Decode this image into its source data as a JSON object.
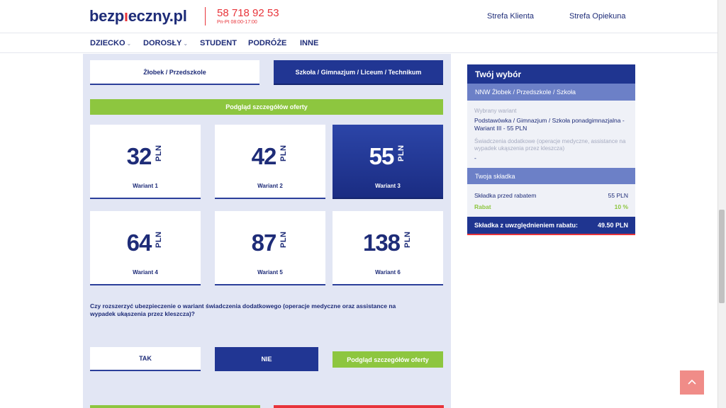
{
  "header": {
    "logo_pre": "bezp",
    "logo_mark": "ı",
    "logo_post": "eczny.pl",
    "phone": "58 718 92 53",
    "hours": "Pn-Pt 08:00-17:00",
    "links": [
      "Strefa Klienta",
      "Strefa Opiekuna"
    ]
  },
  "nav": {
    "items": [
      {
        "label": "DZIECKO",
        "dropdown": "⌄"
      },
      {
        "label": "DOROSŁY",
        "dropdown": "⌄"
      },
      {
        "label": "STUDENT"
      },
      {
        "label": "PODRÓŻE"
      },
      {
        "label": "INNE"
      }
    ]
  },
  "school": {
    "options": [
      "Żłobek / Przedszkole",
      "Szkoła / Gimnazjum / Liceum / Technikum"
    ],
    "selected_index": 1
  },
  "details_label": "Podgląd szczegółów oferty",
  "variants": [
    {
      "price": "32",
      "currency": "PLN",
      "label": "Wariant 1"
    },
    {
      "price": "42",
      "currency": "PLN",
      "label": "Wariant 2"
    },
    {
      "price": "55",
      "currency": "PLN",
      "label": "Wariant 3"
    },
    {
      "price": "64",
      "currency": "PLN",
      "label": "Wariant 4"
    },
    {
      "price": "87",
      "currency": "PLN",
      "label": "Wariant 5"
    },
    {
      "price": "138",
      "currency": "PLN",
      "label": "Wariant 6"
    }
  ],
  "selected_variant_index": 2,
  "extra": {
    "question": "Czy rozszerzyć ubezpieczenie o wariant świadczenia dodatkowego (operacje medyczne oraz assistance na wypadek ukąszenia przez kleszcza)?",
    "yes_label": "TAK",
    "no_label": "NIE",
    "selected": "NIE",
    "details_label": "Podgląd szczegółów oferty"
  },
  "summary": {
    "title": "Twój wybór",
    "product": "NNW Żłobek / Przedszkole / Szkoła",
    "variant_label": "Wybrany wariant",
    "variant_value": "Podstawówka / Gimnazjum / Szkoła ponadgimnazjalna - Wariant III - 55 PLN",
    "extras_label": "Świadczenia dodatkowe (operacje medyczne, assistance na wypadek ukąszenia przez kleszcza)",
    "extras_value": "-",
    "premium_title": "Twoja składka",
    "before_label": "Składka przed rabatem",
    "before_value": "55 PLN",
    "discount_label": "Rabat",
    "discount_value": "10 %",
    "total_label": "Składka z uwzględnieniem rabatu:",
    "total_value": "49.50 PLN"
  },
  "to_top_icon": "chevron-up-icon",
  "colors": {
    "brand_navy": "#1f3590",
    "accent_red": "#e8343a",
    "accent_green": "#8dc63f"
  }
}
